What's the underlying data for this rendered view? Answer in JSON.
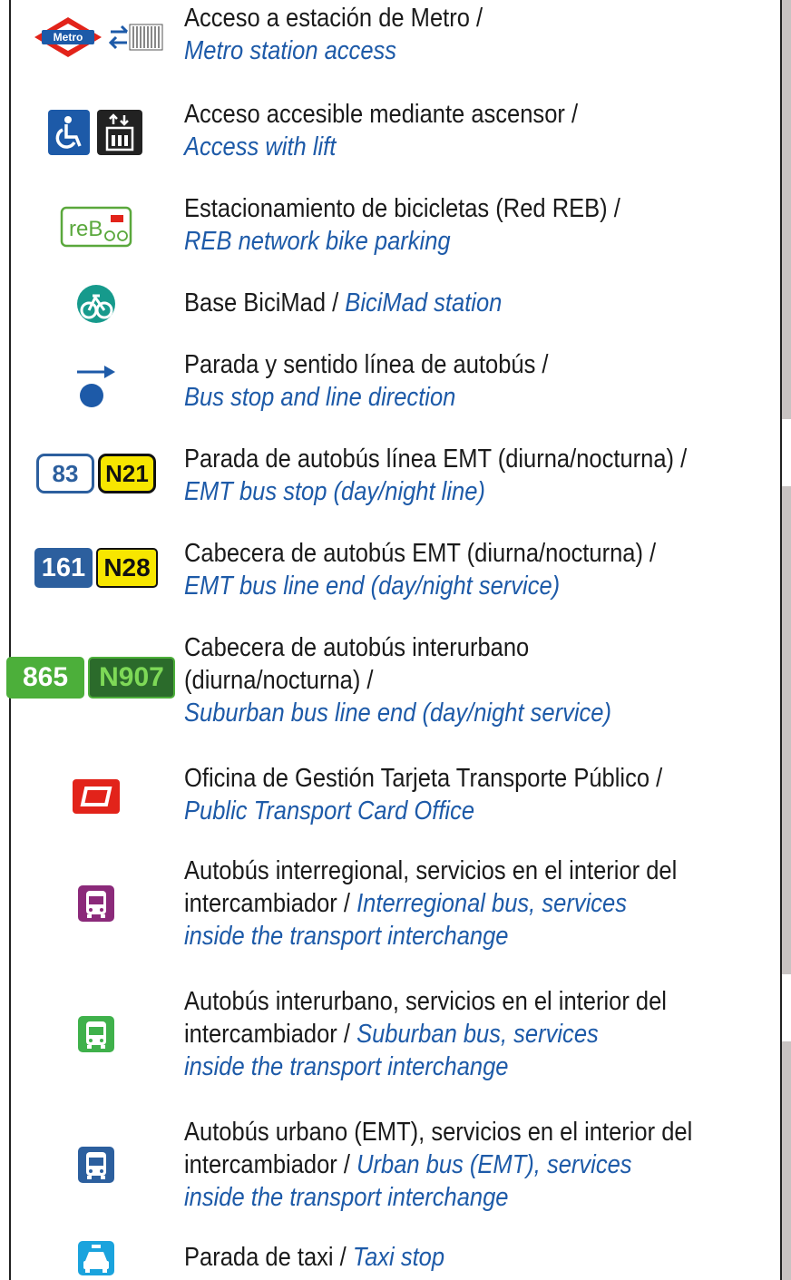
{
  "legend": [
    {
      "es": "Acceso a estación de Metro /",
      "en": "Metro station access",
      "icons": [
        "metro-logo",
        "metro-access-arrows"
      ],
      "metro_label": "Metro"
    },
    {
      "es": "Acceso accesible mediante ascensor /",
      "en": "Access with lift",
      "icons": [
        "wheelchair-icon",
        "lift-icon"
      ]
    },
    {
      "es": "Estacionamiento de bicicletas (Red REB) /",
      "en": "REB network bike parking",
      "icons": [
        "reb-bike-parking-icon"
      ],
      "reb_label": "reB"
    },
    {
      "es": "Base BiciMad /",
      "en": "BiciMad station",
      "icons": [
        "bicimad-icon"
      ]
    },
    {
      "es": "Parada y sentido línea de autobús /",
      "en": "Bus stop and line direction",
      "icons": [
        "bus-stop-direction-icon"
      ]
    },
    {
      "es": "Parada de autobús línea EMT (diurna/nocturna) /",
      "en": "EMT bus stop (day/night line)",
      "badges": [
        "83",
        "N21"
      ]
    },
    {
      "es": "Cabecera de autobús EMT (diurna/nocturna) /",
      "en": "EMT bus line end (day/night service)",
      "badges": [
        "161",
        "N28"
      ]
    },
    {
      "es": "Cabecera de autobús interurbano",
      "es2": "(diurna/nocturna) /",
      "en": "Suburban bus line end (day/night service)",
      "badges": [
        "865",
        "N907"
      ]
    },
    {
      "es": "Oficina de Gestión Tarjeta Transporte Público /",
      "en": "Public Transport Card Office",
      "icons": [
        "transport-card-icon"
      ]
    },
    {
      "es": "Autobús interregional, servicios en el interior del",
      "es2": "intercambiador /",
      "en": "Interregional bus, services",
      "en2": "inside the transport interchange",
      "icons": [
        "interregional-bus-icon"
      ]
    },
    {
      "es": "Autobús interurbano, servicios en el interior del",
      "es2": "intercambiador /",
      "en": "Suburban bus, services",
      "en2": "inside the transport interchange",
      "icons": [
        "suburban-bus-icon"
      ]
    },
    {
      "es": "Autobús urbano (EMT), servicios en el interior del",
      "es2": "intercambiador /",
      "en": "Urban bus (EMT), services",
      "en2": "inside the transport interchange",
      "icons": [
        "urban-bus-icon"
      ]
    },
    {
      "es": "Parada de taxi /",
      "en": "Taxi stop",
      "icons": [
        "taxi-icon"
      ]
    }
  ],
  "colors": {
    "metro_red": "#e2231a",
    "metro_blue": "#1d5aa8",
    "access_blue": "#1d5aa8",
    "reb_green": "#5aa83c",
    "bicimad_teal": "#169a8c",
    "bus_stop_blue": "#1d5aa8",
    "emt_day": "#2c5f9e",
    "night_yellow": "#f7e600",
    "suburban_green": "#4caf3a",
    "suburban_night_bg": "#2b6b2b",
    "card_red": "#e2231a",
    "interregional_purple": "#8b2a7a",
    "suburban_bus_green": "#3fb14b",
    "urban_blue": "#2c5f9e",
    "taxi_cyan": "#1aa3dd",
    "english_text": "#1d5aa8"
  }
}
